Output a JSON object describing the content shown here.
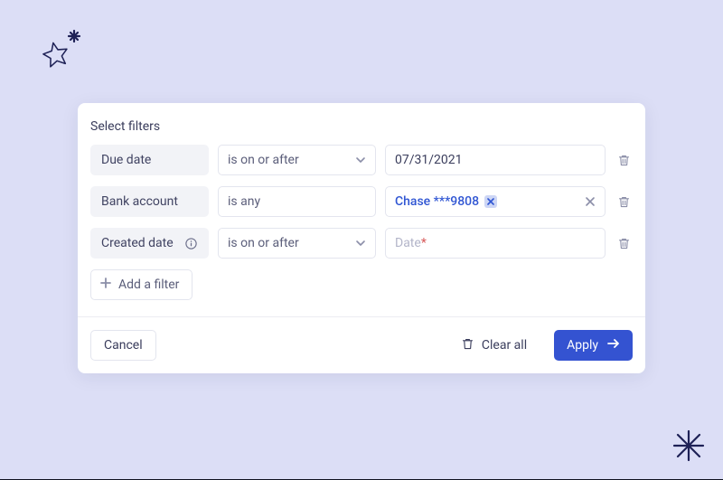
{
  "title": "Select filters",
  "filters": [
    {
      "field_label": "Due date",
      "operator_label": "is on or after",
      "has_caret": true,
      "value": "07/31/2021",
      "placeholder": "",
      "tag": null,
      "has_clear": false,
      "has_info": false
    },
    {
      "field_label": "Bank account",
      "operator_label": "is any",
      "has_caret": false,
      "value": "",
      "placeholder": "",
      "tag": "Chase ***9808",
      "has_clear": true,
      "has_info": false
    },
    {
      "field_label": "Created date",
      "operator_label": "is on or after",
      "has_caret": true,
      "value": "",
      "placeholder": "Date",
      "placeholder_required": "*",
      "tag": null,
      "has_clear": false,
      "has_info": true
    }
  ],
  "add_filter_label": "Add a filter",
  "footer": {
    "cancel_label": "Cancel",
    "clear_all_label": "Clear all",
    "apply_label": "Apply"
  }
}
